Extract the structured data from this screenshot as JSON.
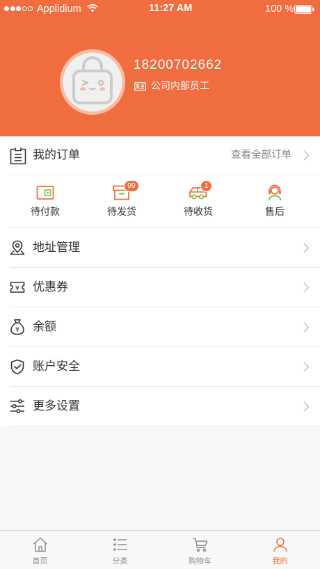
{
  "theme": {
    "accent": "#F06D3F",
    "accent_secondary": "#7CC143",
    "text": "#333333",
    "muted_text": "#888888",
    "tab_inactive": "#8E8E93"
  },
  "status_bar": {
    "signal": {
      "level": 3,
      "max": 5
    },
    "carrier": "Applidium",
    "wifi_icon": "wifi-icon",
    "time": "11:27 AM",
    "battery_text": "100 %",
    "battery_level": 1.0
  },
  "profile": {
    "avatar_icon": "default-avatar-icon",
    "phone": "18200702662",
    "role_icon": "id-card-icon",
    "role": "公司内部员工"
  },
  "orders": {
    "icon": "clipboard-icon",
    "title": "我的订单",
    "view_all": "查看全部订单",
    "statuses": [
      {
        "label": "待付款",
        "icon": "wallet-icon"
      },
      {
        "label": "待发货",
        "icon": "package-icon",
        "badge": "99"
      },
      {
        "label": "待收货",
        "icon": "truck-icon",
        "badge": "1"
      },
      {
        "label": "售后",
        "icon": "customer-service-icon"
      }
    ]
  },
  "menu": [
    {
      "label": "地址管理",
      "icon": "location-pin-icon"
    },
    {
      "label": "优惠券",
      "icon": "coupon-icon",
      "glyph": "¥"
    },
    {
      "label": "余额",
      "icon": "money-bag-icon",
      "glyph": "¥"
    },
    {
      "label": "账户安全",
      "icon": "shield-check-icon"
    },
    {
      "label": "更多设置",
      "icon": "sliders-icon"
    }
  ],
  "tab_bar": {
    "tabs": [
      {
        "label": "首页",
        "icon": "home-icon",
        "active": false
      },
      {
        "label": "分类",
        "icon": "category-list-icon",
        "active": false
      },
      {
        "label": "购物车",
        "icon": "cart-icon",
        "active": false
      },
      {
        "label": "我的",
        "icon": "user-icon",
        "active": true
      }
    ]
  }
}
